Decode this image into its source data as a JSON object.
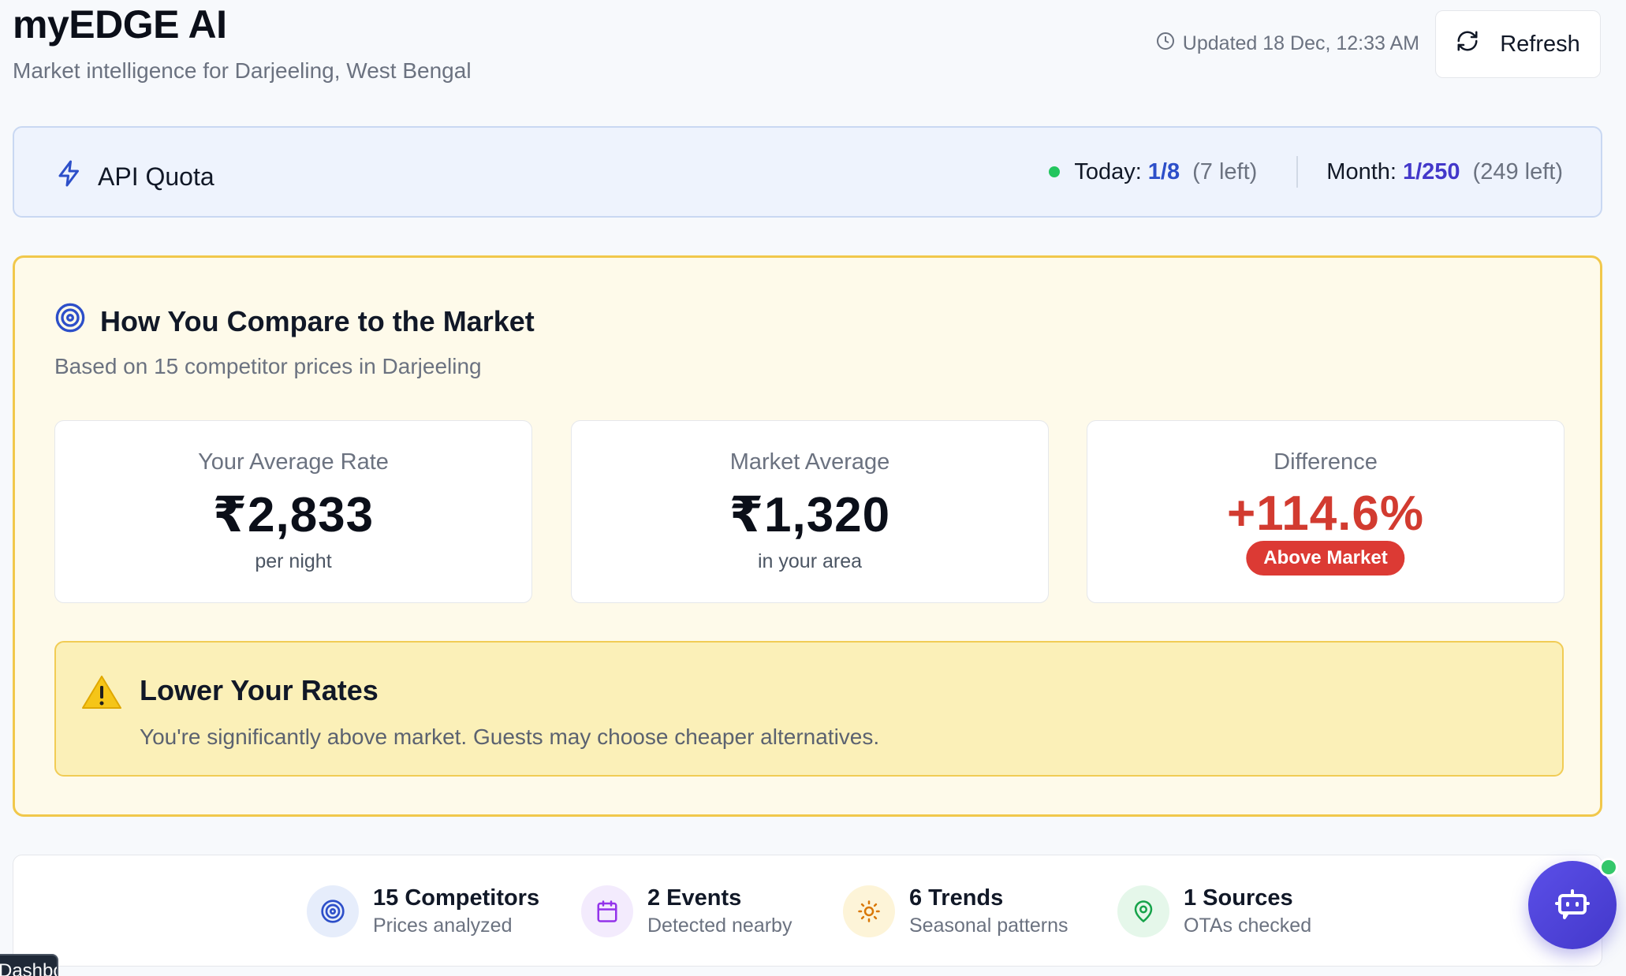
{
  "header": {
    "title": "myEDGE AI",
    "subtitle": "Market intelligence for Darjeeling, West Bengal",
    "updated": "Updated 18 Dec, 12:33 AM",
    "refresh_label": "Refresh"
  },
  "quota": {
    "label": "API Quota",
    "today_label": "Today:",
    "today_value": "1/8",
    "today_left": "(7 left)",
    "month_label": "Month:",
    "month_value": "1/250",
    "month_left": "(249 left)",
    "status_color": "#22c55e"
  },
  "compare": {
    "title": "How You Compare to the Market",
    "subtitle": "Based on 15 competitor prices in Darjeeling",
    "your_rate": {
      "label": "Your Average Rate",
      "value": "₹2,833",
      "note": "per night"
    },
    "market": {
      "label": "Market Average",
      "value": "₹1,320",
      "note": "in your area"
    },
    "difference": {
      "label": "Difference",
      "value": "+114.6%",
      "badge": "Above Market"
    },
    "alert": {
      "title": "Lower Your Rates",
      "text": "You're significantly above market. Guests may choose cheaper alternatives."
    }
  },
  "summary": [
    {
      "title": "15 Competitors",
      "subtitle": "Prices analyzed",
      "icon": "target-icon"
    },
    {
      "title": "2 Events",
      "subtitle": "Detected nearby",
      "icon": "calendar-icon"
    },
    {
      "title": "6 Trends",
      "subtitle": "Seasonal patterns",
      "icon": "sun-icon"
    },
    {
      "title": "1 Sources",
      "subtitle": "OTAs checked",
      "icon": "map-pin-icon"
    }
  ],
  "tooltip": {
    "text": "Dashboard"
  },
  "colors": {
    "accent": "#4338ca",
    "warning_border": "#f1c84b",
    "danger": "#d23b30"
  }
}
